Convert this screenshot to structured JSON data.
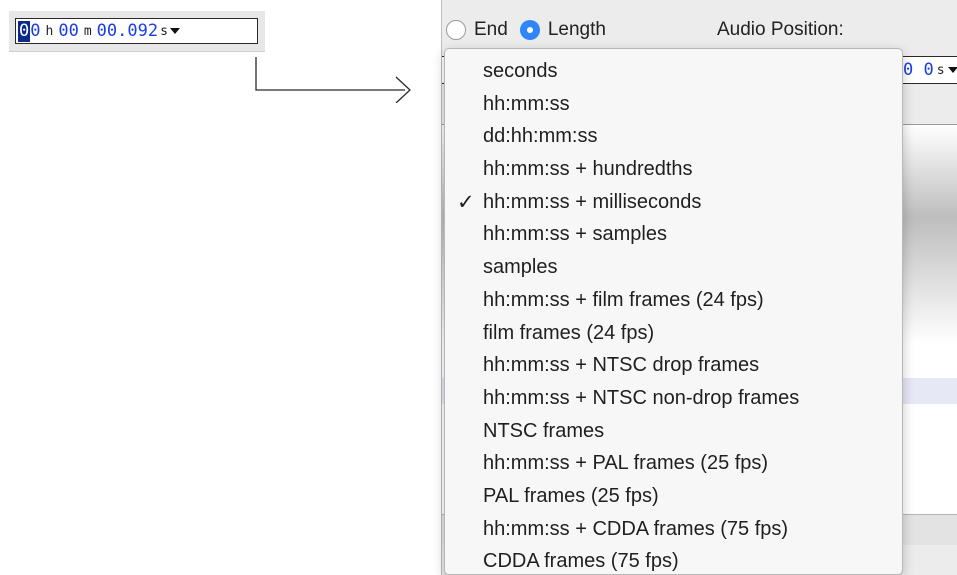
{
  "time_control": {
    "first_digit": "0",
    "hours_rest": "0",
    "hours_unit": "h",
    "minutes": "00",
    "minutes_unit": "m",
    "seconds": "00.092",
    "seconds_unit": "s",
    "dropdown_icon": "triangle-down-icon"
  },
  "radio_group": {
    "end_label": "End",
    "end_checked": false,
    "length_label": "Length",
    "length_checked": true
  },
  "audio_position_label": "Audio Position:",
  "background_field": {
    "digits": "0 0",
    "unit": "s"
  },
  "format_menu": {
    "check_glyph": "✓",
    "selected_index": 4,
    "items": [
      "seconds",
      "hh:mm:ss",
      "dd:hh:mm:ss",
      "hh:mm:ss + hundredths",
      "hh:mm:ss + milliseconds",
      "hh:mm:ss + samples",
      "samples",
      "hh:mm:ss + film frames (24 fps)",
      "film frames (24 fps)",
      "hh:mm:ss + NTSC drop frames",
      "hh:mm:ss + NTSC non-drop frames",
      "NTSC frames",
      "hh:mm:ss + PAL frames (25 fps)",
      "PAL frames (25 fps)",
      "hh:mm:ss + CDDA frames (75 fps)",
      "CDDA frames (75 fps)"
    ]
  },
  "colors": {
    "digit_blue": "#1a3ee6",
    "selected_digit_bg": "#0b2a88",
    "radio_accent": "#2f86f7"
  }
}
